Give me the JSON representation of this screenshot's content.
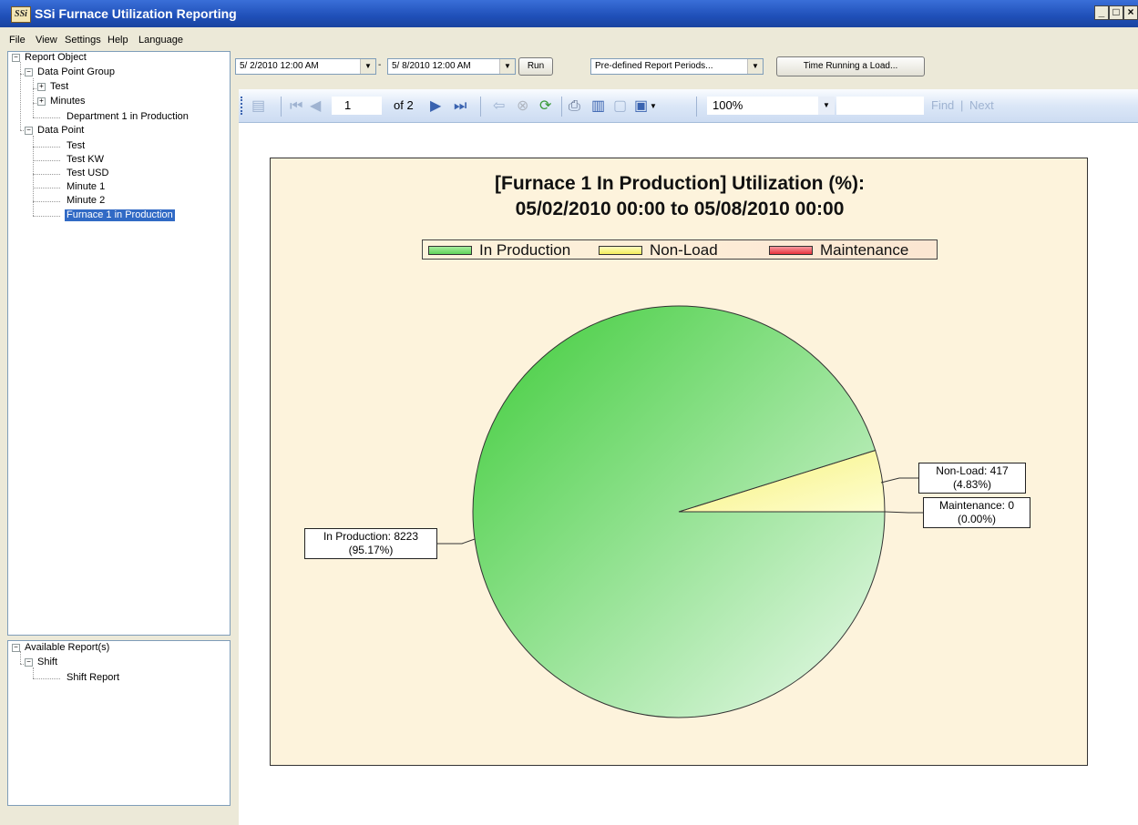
{
  "window": {
    "title": "SSi Furnace Utilization Reporting",
    "icon_text": "SSi",
    "controls": [
      "_",
      "□",
      "×"
    ]
  },
  "menu": [
    "File",
    "View",
    "Settings",
    "Help",
    "Language"
  ],
  "report_object_tree": {
    "root": "Report Object",
    "groups": [
      {
        "label": "Data Point Group",
        "children": [
          "Test",
          "Minutes",
          "Department 1 in Production"
        ]
      },
      {
        "label": "Data Point",
        "children": [
          "Test",
          "Test KW",
          "Test USD",
          "Minute 1",
          "Minute 2",
          "Furnace 1 in Production"
        ],
        "selected": "Furnace 1 in Production"
      }
    ]
  },
  "available_reports_tree": {
    "root": "Available Report(s)",
    "group": "Shift",
    "item": "Shift Report"
  },
  "parameters": {
    "start_date": "5/ 2/2010 12:00 AM",
    "separator": "-",
    "end_date": "5/ 8/2010 12:00 AM",
    "run_label": "Run",
    "period_select": "Pre-defined Report Periods...",
    "time_running_label": "Time Running a Load..."
  },
  "viewer_toolbar": {
    "current_page": "1",
    "of_pages": "of 2",
    "zoom": "100%",
    "find_label": "Find",
    "find_sep": "|",
    "next_label": "Next"
  },
  "chart_data": {
    "type": "pie",
    "title_line1": "[Furnace 1 In Production] Utilization (%):",
    "title_line2": "05/02/2010 00:00 to 05/08/2010 00:00",
    "legend_placement": "top",
    "series": [
      {
        "name": "In Production",
        "value": 8223,
        "percent": 95.17,
        "color": "#5fd35a",
        "label_line1": "In Production: 8223",
        "label_line2": "(95.17%)"
      },
      {
        "name": "Non-Load",
        "value": 417,
        "percent": 4.83,
        "color": "#f9f58a",
        "label_line1": "Non-Load: 417",
        "label_line2": "(4.83%)"
      },
      {
        "name": "Maintenance",
        "value": 0,
        "percent": 0.0,
        "color": "#e8323c",
        "label_line1": "Maintenance: 0",
        "label_line2": "(0.00%)"
      }
    ]
  },
  "icons": {
    "first_page": "first-page-icon",
    "prev_page": "previous-page-icon",
    "next_page": "next-page-icon",
    "last_page": "last-page-icon",
    "back": "back-icon",
    "stop": "stop-icon",
    "refresh": "refresh-icon",
    "print": "print-icon",
    "print_layout": "print-layout-icon",
    "page_setup": "page-setup-icon",
    "export": "save-icon",
    "toggle_map": "document-map-icon"
  }
}
